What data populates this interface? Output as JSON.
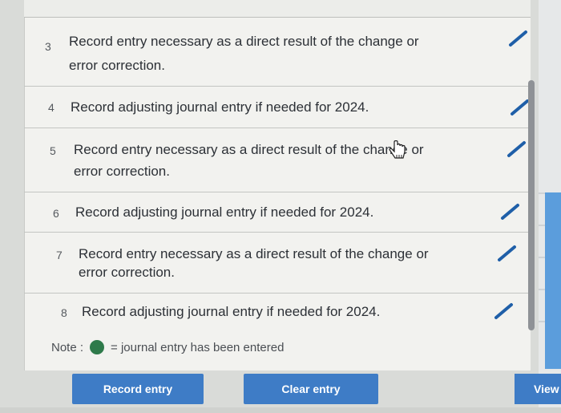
{
  "rows": [
    {
      "number": "3",
      "text_line1": "Record entry necessary as a direct result of the change or",
      "text_line2": "error correction."
    },
    {
      "number": "4",
      "text_line1": "Record adjusting journal entry if needed for 2024.",
      "text_line2": ""
    },
    {
      "number": "5",
      "text_line1": "Record entry necessary as a direct result of the change or",
      "text_line2": "error correction."
    },
    {
      "number": "6",
      "text_line1": "Record adjusting journal entry if needed for 2024.",
      "text_line2": ""
    },
    {
      "number": "7",
      "text_line1": "Record entry necessary as a direct result of the change or",
      "text_line2": "error correction."
    },
    {
      "number": "8",
      "text_line1": "Record adjusting journal entry if needed for 2024.",
      "text_line2": ""
    }
  ],
  "note": {
    "prefix": "Note :",
    "suffix": "= journal entry has been entered",
    "dot_color": "#2e7a4a"
  },
  "buttons": {
    "record": "Record entry",
    "clear": "Clear entry",
    "view": "View"
  },
  "colors": {
    "accent": "#3e7cc6",
    "pencil": "#1f5fa8"
  }
}
